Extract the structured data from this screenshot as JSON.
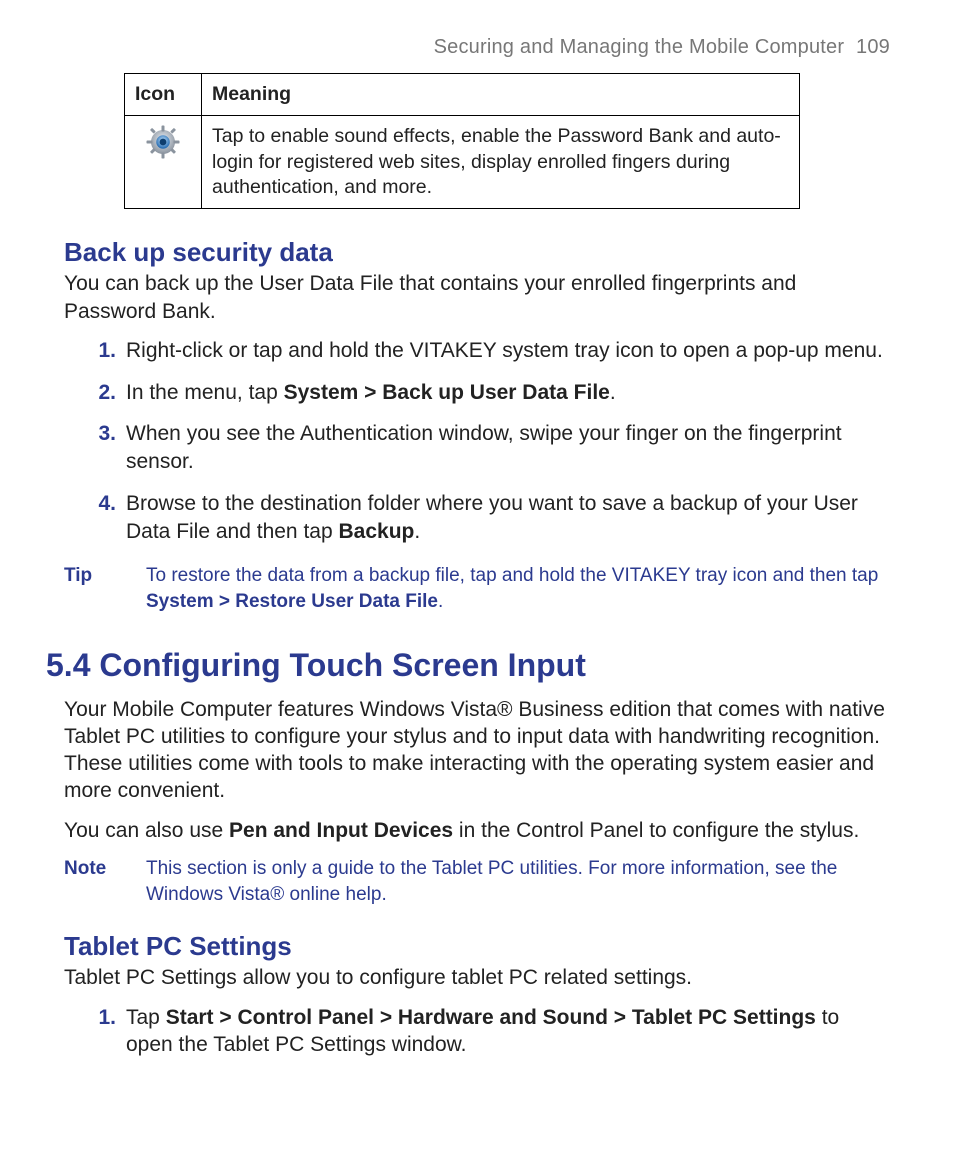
{
  "header": {
    "title": "Securing and Managing the Mobile Computer",
    "page_number": "109"
  },
  "icon_table": {
    "head_icon": "Icon",
    "head_meaning": "Meaning",
    "row_meaning": "Tap to enable sound effects, enable the Password Bank and auto-login for registered web sites, display enrolled fingers during authentication, and more.",
    "row_icon_name": "settings-gear-icon"
  },
  "backup": {
    "heading": "Back up security data",
    "intro": "You can back up the User Data File that contains your enrolled fingerprints and Password Bank.",
    "steps": [
      {
        "num": "1.",
        "text": "Right-click or tap and hold the VITAKEY system tray icon to open a pop-up menu."
      },
      {
        "num": "2.",
        "prefix": "In the menu, tap ",
        "bold": "System > Back up User Data File",
        "suffix": "."
      },
      {
        "num": "3.",
        "text": "When you see the Authentication window, swipe your finger on the fingerprint sensor."
      },
      {
        "num": "4.",
        "prefix": "Browse to the destination folder where you want to save a backup of your User Data File and then tap ",
        "bold": "Backup",
        "suffix": "."
      }
    ],
    "tip_label": "Tip",
    "tip_prefix": "To restore the data from a backup file, tap and hold the VITAKEY tray icon and then tap ",
    "tip_bold": "System > Restore User Data File",
    "tip_suffix": "."
  },
  "section": {
    "heading": "5.4  Configuring Touch Screen Input",
    "para1": "Your Mobile Computer features Windows Vista® Business edition that comes with native Tablet PC utilities to configure your stylus and to input data with handwriting recognition. These utilities come with tools to make interacting with the operating system easier and more convenient.",
    "para2_prefix": "You can also use ",
    "para2_bold": "Pen and Input Devices",
    "para2_suffix": " in the Control Panel to configure the stylus.",
    "note_label": "Note",
    "note_text": "This section is only a guide to the Tablet PC utilities. For more information, see the Windows Vista® online help."
  },
  "tablet": {
    "heading": "Tablet PC Settings",
    "intro": "Tablet PC Settings allow you to configure tablet PC related settings.",
    "steps": [
      {
        "num": "1.",
        "prefix": "Tap ",
        "bold": "Start > Control Panel > Hardware and Sound > Tablet PC Settings",
        "suffix": " to open the Tablet PC Settings window."
      }
    ]
  }
}
